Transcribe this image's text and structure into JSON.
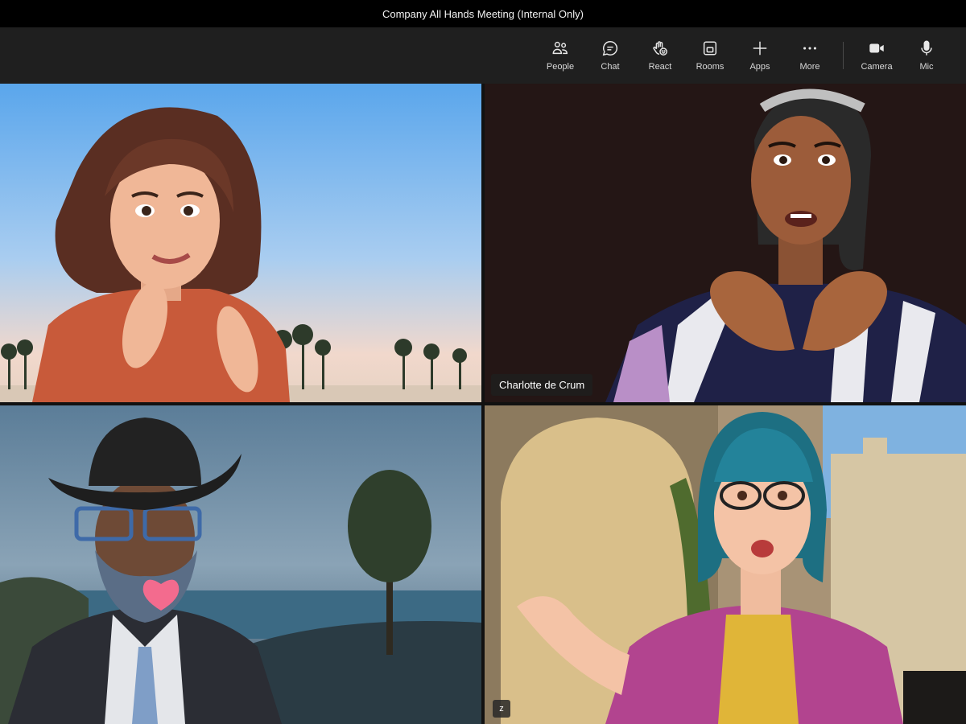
{
  "window": {
    "title": "Company All Hands Meeting (Internal Only)"
  },
  "toolbar": {
    "buttons": [
      {
        "label": "People",
        "icon": "people-icon"
      },
      {
        "label": "Chat",
        "icon": "chat-icon"
      },
      {
        "label": "React",
        "icon": "react-icon"
      },
      {
        "label": "Rooms",
        "icon": "rooms-icon"
      },
      {
        "label": "Apps",
        "icon": "plus-icon"
      },
      {
        "label": "More",
        "icon": "more-icon"
      }
    ],
    "media": [
      {
        "label": "Camera",
        "icon": "camera-icon"
      },
      {
        "label": "Mic",
        "icon": "mic-icon"
      }
    ]
  },
  "participants": [
    {
      "name": "",
      "tile": "beach-avatar"
    },
    {
      "name": "Charlotte de Crum",
      "tile": "heart-hands-avatar"
    },
    {
      "name": "",
      "tile": "cowboy-avatar"
    },
    {
      "name": "",
      "tile": "castle-avatar",
      "tag": "z"
    }
  ]
}
